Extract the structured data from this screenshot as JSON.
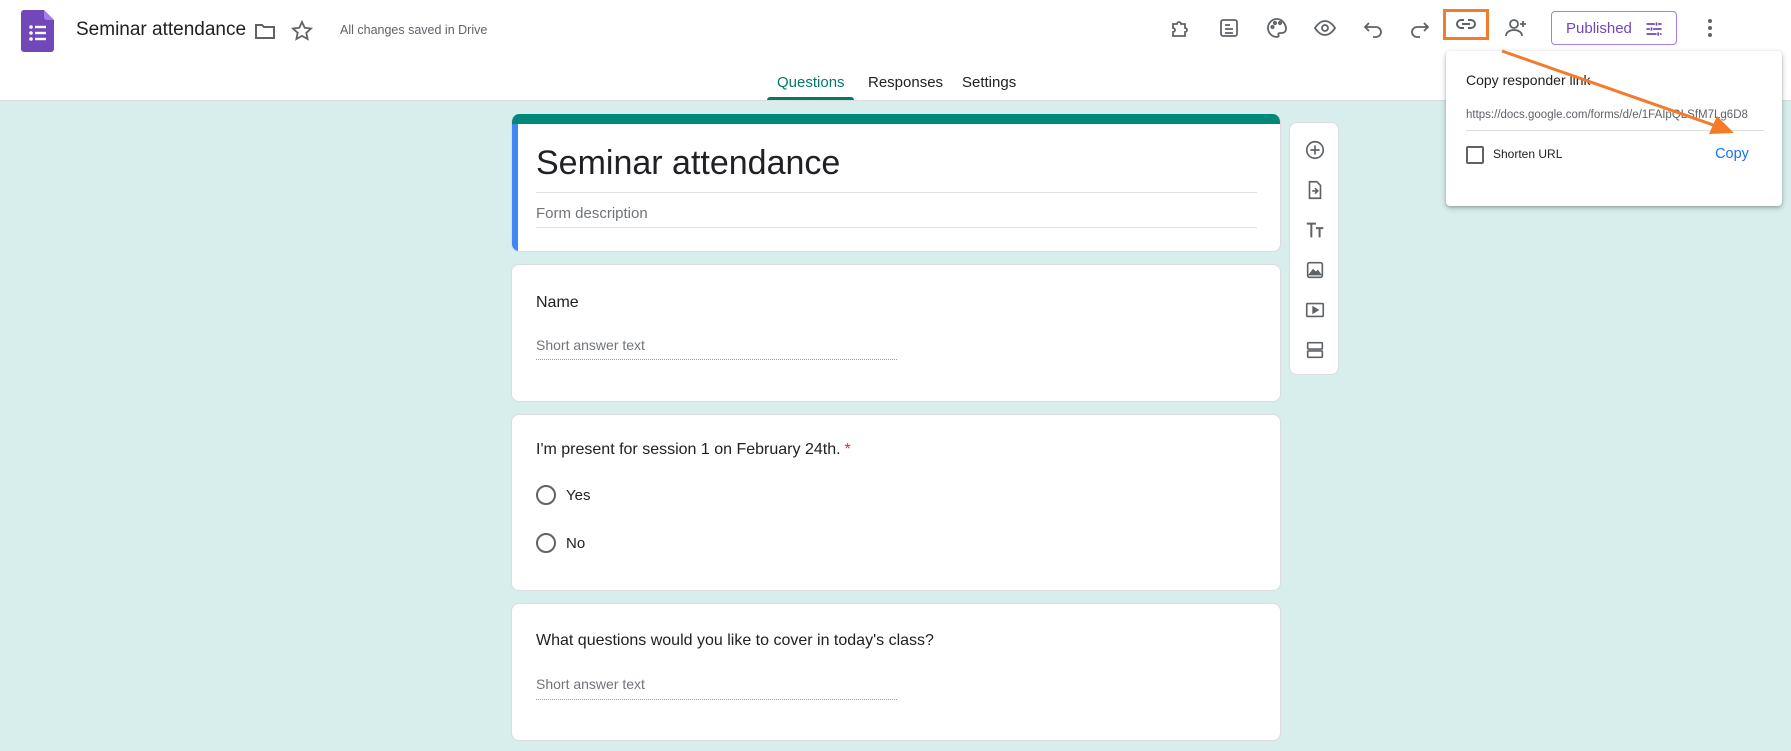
{
  "header": {
    "title": "Seminar attendance",
    "save_status": "All changes saved in Drive",
    "publish_label": "Published"
  },
  "tabs": [
    {
      "label": "Questions",
      "active": true
    },
    {
      "label": "Responses",
      "active": false
    },
    {
      "label": "Settings",
      "active": false
    }
  ],
  "form": {
    "title": "Seminar attendance",
    "description_placeholder": "Form description"
  },
  "questions": [
    {
      "title": "Name",
      "type": "short-answer",
      "placeholder": "Short answer text",
      "required": false
    },
    {
      "title": "I'm present for session 1 on February 24th.",
      "type": "multiple-choice",
      "required": true,
      "options": [
        "Yes",
        "No"
      ]
    },
    {
      "title": "What questions would you like to cover in today's class?",
      "type": "short-answer",
      "placeholder": "Short answer text",
      "required": false
    }
  ],
  "popup": {
    "title": "Copy responder link",
    "url": "https://docs.google.com/forms/d/e/1FAIpQLSfM7Lg6D8",
    "shorten_label": "Shorten URL",
    "copy_label": "Copy"
  },
  "icons": {
    "toolbar": [
      "addons-icon",
      "customize-icon",
      "palette-icon",
      "preview-icon",
      "undo-icon",
      "redo-icon",
      "link-icon",
      "add-collaborator-icon",
      "more-vert-icon"
    ],
    "side": [
      "add-question-icon",
      "import-questions-icon",
      "add-title-icon",
      "add-image-icon",
      "add-video-icon",
      "add-section-icon"
    ]
  },
  "colors": {
    "accent": "#00796b",
    "background": "#d7eeec",
    "highlight": "#f47b2a",
    "publish": "#7248b9"
  }
}
